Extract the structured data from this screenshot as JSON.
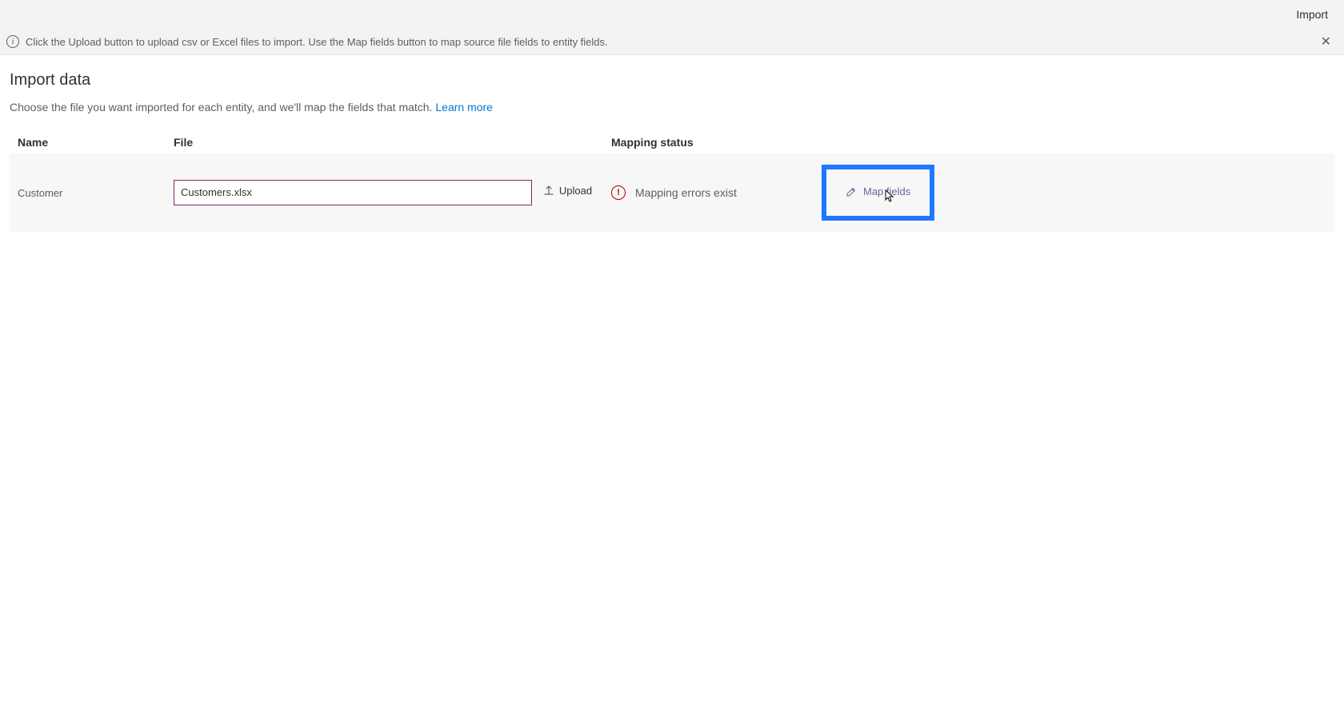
{
  "topBar": {
    "import": "Import"
  },
  "banner": {
    "text": "Click the Upload button to upload csv or Excel files to import. Use the Map fields button to map source file fields to entity fields."
  },
  "page": {
    "title": "Import data",
    "subtitle": "Choose the file you want imported for each entity, and we'll map the fields that match. ",
    "learnMore": "Learn more"
  },
  "columns": {
    "name": "Name",
    "file": "File",
    "status": "Mapping status"
  },
  "rows": [
    {
      "entity": "Customer",
      "file": "Customers.xlsx",
      "uploadLabel": "Upload",
      "statusText": "Mapping errors exist",
      "mapFieldsLabel": "Map fields"
    }
  ]
}
